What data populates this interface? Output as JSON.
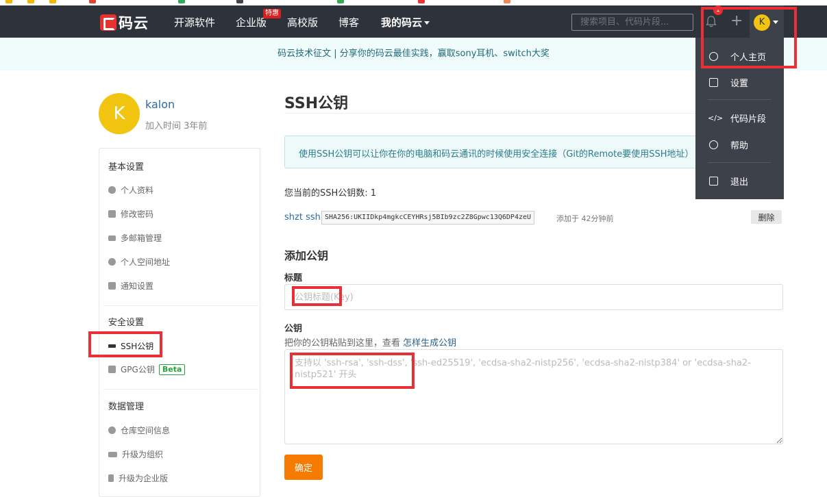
{
  "brand": {
    "name": "码云"
  },
  "nav": {
    "items": [
      "开源软件",
      "企业版",
      "高校版",
      "博客"
    ],
    "badge": "特惠",
    "mine": "我的码云",
    "search_placeholder": "搜索项目、代码片段...",
    "notification_count": "1",
    "avatar_initial": "K"
  },
  "banner": {
    "text": "码云技术征文 | 分享你的码云最佳实践，赢取sony耳机、switch大奖"
  },
  "profile": {
    "initial": "K",
    "username": "kalon",
    "joined": "加入时间 3年前"
  },
  "sidebar": {
    "basic_title": "基本设置",
    "basic_items": [
      "个人资料",
      "修改密码",
      "多邮箱管理",
      "个人空间地址",
      "通知设置"
    ],
    "security_title": "安全设置",
    "security_items": [
      "SSH公钥",
      "GPG公钥"
    ],
    "beta": "Beta",
    "data_title": "数据管理",
    "data_items": [
      "仓库空间信息",
      "升级为组织",
      "升级为企业版"
    ]
  },
  "main": {
    "title": "SSH公钥",
    "info": "使用SSH公钥可以让你在你的电脑和码云通讯的时候使用安全连接（Git的Remote要使用SSH地址）",
    "count": "您当前的SSH公钥数: 1",
    "key": {
      "name": "shzt ssh",
      "fingerprint": "SHA256:UKIIDkp4mgkcCEYHRsj5BIb9zc2Z8Gpwc13Q6DP4zeU",
      "added": "添加于 42分钟前",
      "delete": "删除"
    },
    "add_title": "添加公钥",
    "title_label": "标题",
    "title_placeholder": "公钥标题(Key)",
    "key_label": "公钥",
    "hint_prefix": "把你的公钥粘贴到这里，查看",
    "hint_link": "怎样生成公钥",
    "key_placeholder": "支持以 'ssh-rsa', 'ssh-dss', 'ssh-ed25519', 'ecdsa-sha2-nistp256', 'ecdsa-sha2-nistp384' or 'ecdsa-sha2-nistp521' 开头",
    "submit": "确定"
  },
  "dropdown": {
    "items": [
      "个人主页",
      "设置",
      "代码片段",
      "帮助",
      "退出"
    ],
    "icons": [
      "user-icon",
      "edit-icon",
      "code-icon",
      "help-icon",
      "logout-icon"
    ]
  },
  "colors": {
    "header": "#2e323a",
    "accent": "#f57c00",
    "annotation": "#ea2f36",
    "avatar": "#f1c40f"
  }
}
